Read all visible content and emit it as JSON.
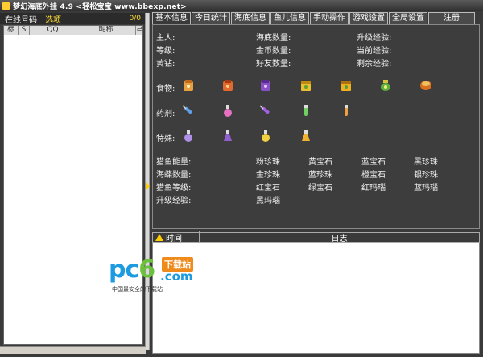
{
  "window": {
    "title": "梦幻海底外挂 4.9 <轻松宝宝 www.bbexp.net>"
  },
  "left": {
    "online_label": "在线号码",
    "options_label": "选项",
    "count": "0/0",
    "columns": [
      "标",
      "S",
      "QQ",
      "昵称",
      "ㄹ"
    ]
  },
  "tabs": [
    "基本信息",
    "今日统计",
    "海底信息",
    "鱼儿信息",
    "手动操作",
    "游戏设置",
    "全局设置",
    "注册"
  ],
  "stats": {
    "master": "主人:",
    "level": "等级:",
    "yellow_diamond": "黄钻:",
    "seabed_count": "海底数量:",
    "gold_count": "金币数量:",
    "friend_count": "好友数量:",
    "upgrade_exp": "升级经验:",
    "current_exp": "当前经验:",
    "remaining_exp": "剩余经验:"
  },
  "rows": {
    "food": "食物:",
    "medicine": "药剂:",
    "special": "特殊:"
  },
  "fishing": {
    "energy": "猎鱼能量:",
    "butterflies": "海蝶数量:",
    "level": "猎鱼等级:",
    "upgrade_exp": "升级经验:"
  },
  "pearls": {
    "pink_pearl": "粉珍珠",
    "yellow_gem": "黄宝石",
    "blue_gem": "蓝宝石",
    "black_pearl": "黑珍珠",
    "gold_pearl": "金珍珠",
    "blue_pearl": "蓝珍珠",
    "orange_gem": "橙宝石",
    "silver_pearl": "银珍珠",
    "red_gem": "红宝石",
    "green_gem": "绿宝石",
    "red_agate": "红玛瑙",
    "blue_agate": "蓝玛瑙",
    "black_agate": "黑玛瑙"
  },
  "log": {
    "time": "时间",
    "log": "日志"
  },
  "watermark": {
    "pc": "pc",
    "six": "6",
    "download": "下载站",
    "com": ".com",
    "slogan": "中国最安全的下载站"
  }
}
